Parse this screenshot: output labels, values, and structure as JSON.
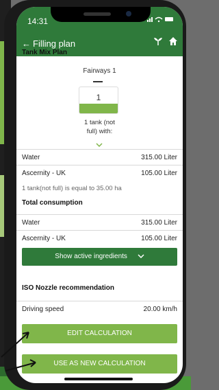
{
  "status": {
    "time": "14:31"
  },
  "nav": {
    "back_arrow": "←",
    "title": "Filling plan"
  },
  "tank_mix": {
    "title": "Tank Mix Plan",
    "field_name": "Fairways 1",
    "tank_count": "1",
    "tank_note_line1": "1 tank (not",
    "tank_note_line2": "full) with:"
  },
  "mix_rows": [
    {
      "label": "Water",
      "value": "315.00 Liter"
    },
    {
      "label": "Ascernity - UK",
      "value": "105.00 Liter"
    }
  ],
  "equivalence_note": "1 tank(not full) is equal to 35.00 ha",
  "total": {
    "title": "Total consumption",
    "rows": [
      {
        "label": "Water",
        "value": "315.00 Liter"
      },
      {
        "label": "Ascernity - UK",
        "value": "105.00 Liter"
      }
    ]
  },
  "ingredients_button": {
    "label": "Show active ingredients"
  },
  "nozzle": {
    "title": "ISO Nozzle recommendation",
    "speed_label": "Driving speed",
    "speed_value": "20.00 km/h"
  },
  "actions": {
    "edit": "EDIT CALCULATION",
    "new": "USE AS NEW CALCULATION"
  },
  "colors": {
    "header": "#2f7a3a",
    "button_dark": "#2f7a3a",
    "button_light": "#80b64a"
  },
  "icons": [
    "back-arrow-icon",
    "plant-icon",
    "home-icon",
    "chevron-down-icon",
    "signal-icon",
    "wifi-icon",
    "battery-icon"
  ]
}
